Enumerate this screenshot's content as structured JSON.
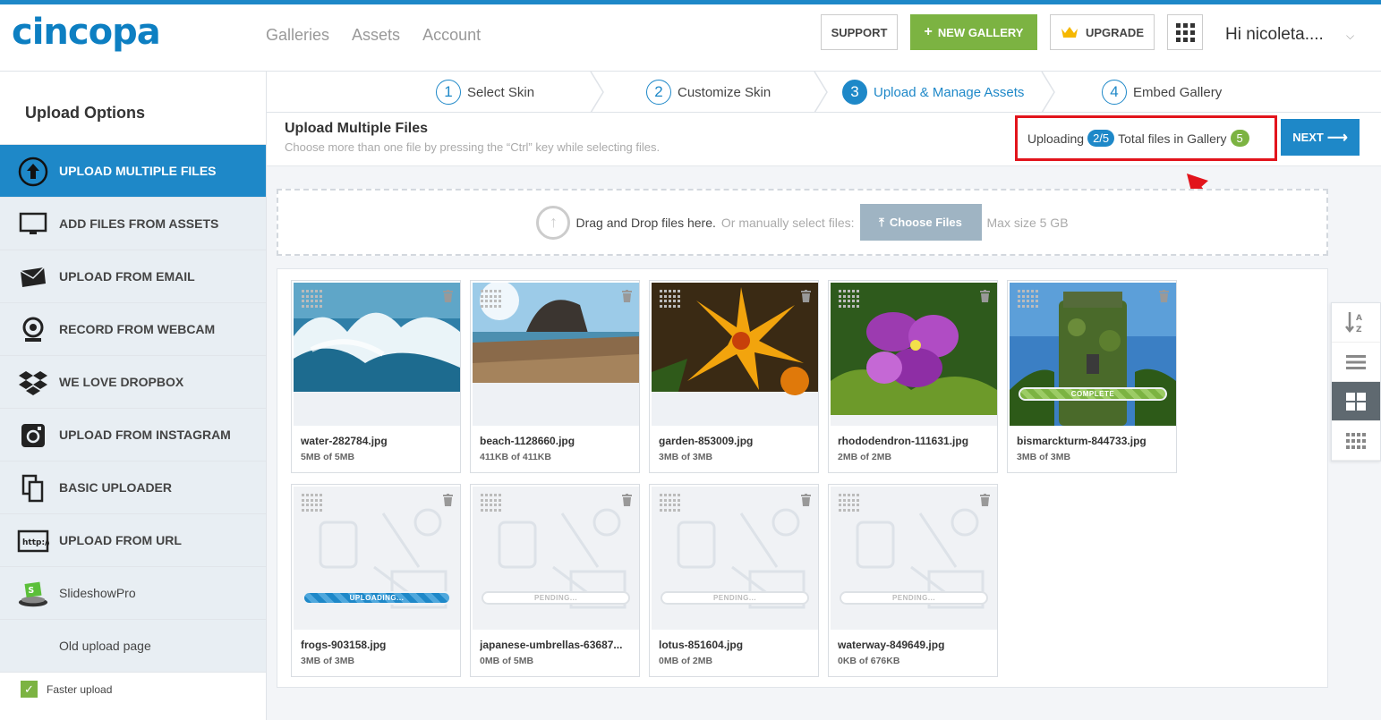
{
  "header": {
    "logo": "cincopa",
    "nav": [
      "Galleries",
      "Assets",
      "Account"
    ],
    "support": "SUPPORT",
    "new_gallery": "NEW GALLERY",
    "upgrade": "UPGRADE",
    "user": "Hi nicoleta....",
    "accent": "#1e88c8",
    "green": "#7cb342"
  },
  "sidebar": {
    "title": "Upload Options",
    "items": [
      {
        "label": "UPLOAD MULTIPLE FILES",
        "icon": "upload-circle-icon"
      },
      {
        "label": "ADD FILES FROM ASSETS",
        "icon": "monitor-icon"
      },
      {
        "label": "UPLOAD FROM EMAIL",
        "icon": "envelope-icon"
      },
      {
        "label": "RECORD FROM WEBCAM",
        "icon": "webcam-icon"
      },
      {
        "label": "WE LOVE DROPBOX",
        "icon": "dropbox-icon"
      },
      {
        "label": "UPLOAD FROM INSTAGRAM",
        "icon": "instagram-icon"
      },
      {
        "label": "BASIC UPLOADER",
        "icon": "copy-icon"
      },
      {
        "label": "UPLOAD FROM URL",
        "icon": "url-icon"
      },
      {
        "label": "SlideshowPro",
        "icon": "slideshowpro-icon"
      },
      {
        "label": "Old upload page",
        "icon": ""
      }
    ],
    "faster_upload": "Faster upload"
  },
  "steps": [
    {
      "num": "1",
      "label": "Select Skin"
    },
    {
      "num": "2",
      "label": "Customize Skin"
    },
    {
      "num": "3",
      "label": "Upload & Manage Assets"
    },
    {
      "num": "4",
      "label": "Embed Gallery"
    }
  ],
  "upload": {
    "title": "Upload Multiple Files",
    "subtitle": "Choose more than one file by pressing the “Ctrl” key while selecting files.",
    "uploading_label": "Uploading",
    "uploading_count": "2/5",
    "total_label": "Total files in Gallery",
    "total_count": "5",
    "next": "NEXT"
  },
  "dropzone": {
    "text": "Drag and Drop files here.",
    "or": "Or manually select files:",
    "choose": "Choose Files",
    "max": "Max size 5 GB"
  },
  "files": [
    {
      "name": "water-282784.jpg",
      "size": "5MB of 5MB",
      "image": "water"
    },
    {
      "name": "beach-1128660.jpg",
      "size": "411KB of 411KB",
      "image": "beach"
    },
    {
      "name": "garden-853009.jpg",
      "size": "3MB of 3MB",
      "image": "garden"
    },
    {
      "name": "rhododendron-111631.jpg",
      "size": "2MB of 2MB",
      "image": "rhododendron"
    },
    {
      "name": "bismarckturm-844733.jpg",
      "size": "3MB of 3MB",
      "image": "tower",
      "status": "COMPLETE"
    },
    {
      "name": "frogs-903158.jpg",
      "size": "3MB of 3MB",
      "status": "UPLOADING..."
    },
    {
      "name": "japanese-umbrellas-63687...",
      "size": "0MB of 5MB",
      "status": "PENDING..."
    },
    {
      "name": "lotus-851604.jpg",
      "size": "0MB of 2MB",
      "status": "PENDING..."
    },
    {
      "name": "waterway-849649.jpg",
      "size": "0KB of 676KB",
      "status": "PENDING..."
    }
  ],
  "view_tools": [
    "sort-az-icon",
    "list-view-icon",
    "grid-view-icon",
    "small-grid-icon"
  ]
}
